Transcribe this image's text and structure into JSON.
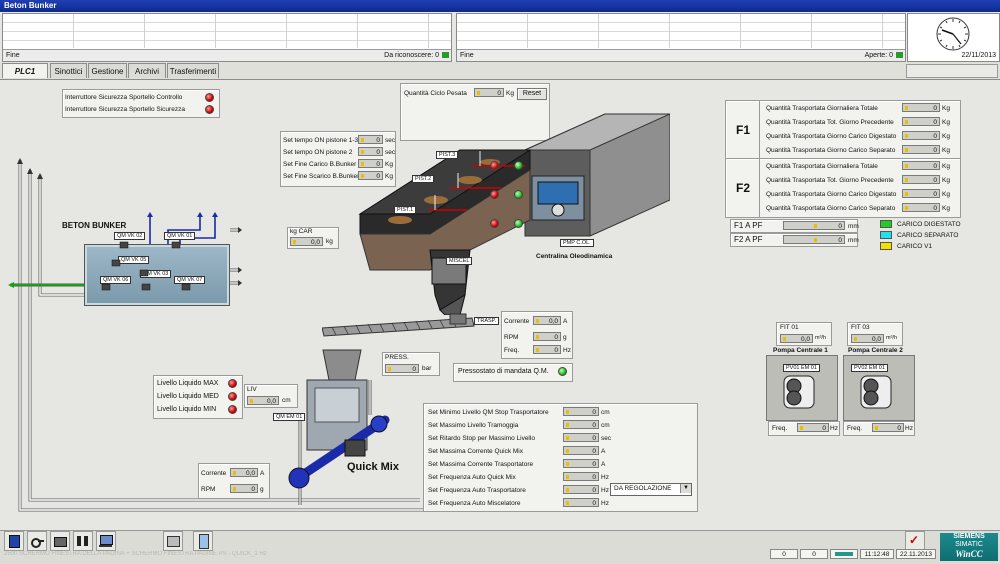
{
  "window": {
    "title": "Beton Bunker"
  },
  "alarms": {
    "left": {
      "footer_left": "Fine",
      "footer_right": "Da riconoscere: 0"
    },
    "right": {
      "footer_left": "Fine",
      "footer_right": "Aperte: 0"
    }
  },
  "clock": {
    "date": "22/11/2013"
  },
  "tabs": {
    "plc": "PLC1",
    "items": [
      "Sinottici",
      "Gestione",
      "Archivi",
      "Trasferimenti"
    ]
  },
  "safety": {
    "items": [
      "Interruttore Sicurezza Sportello Controllo",
      "Interruttore Sicurezza Sportello Sicurezza"
    ]
  },
  "ciclo": {
    "label": "Quantità Ciclo Pesata",
    "value": "0",
    "unit": "Kg",
    "reset": "Reset"
  },
  "setpoints": {
    "items": [
      {
        "label": "Set tempo ON pistone 1-3",
        "value": "0",
        "unit": "sec"
      },
      {
        "label": "Set tempo ON pistone 2",
        "value": "0",
        "unit": "sec"
      },
      {
        "label": "Set Fine Carico B.Bunker",
        "value": "0",
        "unit": "Kg"
      },
      {
        "label": "Set Fine Scarico B.Bunker",
        "value": "0",
        "unit": "Kg"
      }
    ]
  },
  "kgcar": {
    "label": "kg CAR",
    "value": "0,0",
    "unit": "kg"
  },
  "bunker": {
    "title": "BETON BUNKER",
    "valves": [
      "QM VK 02",
      "QM VK 01",
      "QM VK 05",
      "QM VK 03",
      "QM VK 06",
      "QM VK 07"
    ]
  },
  "machine": {
    "pistons": [
      "PIST.3",
      "PIST.2",
      "PIST.1"
    ],
    "miscel": "MISCEL",
    "pmp": "PMP C.OL.",
    "centralina": "Centralina Oleodinamica",
    "trasp": "TRASP."
  },
  "trasp_values": [
    {
      "label": "Corrente",
      "value": "0,0",
      "unit": "A"
    },
    {
      "label": "RPM",
      "value": "0",
      "unit": "g"
    },
    {
      "label": "Freq.",
      "value": "0",
      "unit": "Hz"
    }
  ],
  "pressostato": {
    "label": "Pressostato di mandata Q.M."
  },
  "press": {
    "label": "PRESS.",
    "value": "0",
    "unit": "bar"
  },
  "liv": {
    "label": "LIV",
    "value": "0,0",
    "unit": "cm"
  },
  "livelli": {
    "items": [
      "Livello Liquido MAX",
      "Livello Liquido MED",
      "Livello Liquido MIN"
    ]
  },
  "quickmix": {
    "title": "Quick Mix",
    "em": "QM EM 01",
    "values": [
      {
        "label": "Corrente",
        "value": "0,0",
        "unit": "A"
      },
      {
        "label": "RPM",
        "value": "0",
        "unit": "g"
      }
    ]
  },
  "f1": {
    "title": "F1",
    "rows": [
      {
        "label": "Quantità Trasportata Giornaliera Totale",
        "value": "0",
        "unit": "Kg"
      },
      {
        "label": "Quantità Trasportata Tot. Giorno Precedente",
        "value": "0",
        "unit": "Kg"
      },
      {
        "label": "Quantità Trasportata Giorno Carico Digestato",
        "value": "0",
        "unit": "Kg"
      },
      {
        "label": "Quantità Trasportata Giorno Carico Separato",
        "value": "0",
        "unit": "Kg"
      }
    ]
  },
  "f2": {
    "title": "F2",
    "rows": [
      {
        "label": "Quantità Trasportata Giornaliera Totale",
        "value": "0",
        "unit": "Kg"
      },
      {
        "label": "Quantità Trasportata Tot. Giorno Precedente",
        "value": "0",
        "unit": "Kg"
      },
      {
        "label": "Quantità Trasportata Giorno Carico Digestato",
        "value": "0",
        "unit": "Kg"
      },
      {
        "label": "Quantità Trasportata Giorno Carico Separato",
        "value": "0",
        "unit": "Kg"
      }
    ]
  },
  "pf": [
    {
      "label": "F1 A PF",
      "value": "0",
      "unit": "mm"
    },
    {
      "label": "F2 A PF",
      "value": "0",
      "unit": "mm"
    }
  ],
  "legend": [
    {
      "label": "CARICO DIGESTATO",
      "color": "#22cc22"
    },
    {
      "label": "CARICO SEPARATO",
      "color": "#22e0ee"
    },
    {
      "label": "CARICO V1",
      "color": "#f2e200"
    }
  ],
  "pumps": [
    {
      "fit": "FIT 01",
      "fit_value": "0,0",
      "fit_unit": "m³/h",
      "title": "Pompa Centrale 1",
      "em": "PV01 EM 01",
      "freq_label": "Freq.",
      "freq": "0",
      "freq_unit": "Hz"
    },
    {
      "fit": "FIT 03",
      "fit_value": "0,0",
      "fit_unit": "m³/h",
      "title": "Pompa Centrale 2",
      "em": "PV02 EM 01",
      "freq_label": "Freq.",
      "freq": "0",
      "freq_unit": "Hz"
    }
  ],
  "settings": {
    "rows": [
      {
        "label": "Set Minimo Livello QM Stop Trasportatore",
        "value": "0",
        "unit": "cm"
      },
      {
        "label": "Set Massimo Livello Tramoggia",
        "value": "0",
        "unit": "cm"
      },
      {
        "label": "Set Ritardo Stop per Massimo Livello",
        "value": "0",
        "unit": "sec"
      },
      {
        "label": "Set Massima Corrente Quick Mix",
        "value": "0",
        "unit": "A"
      },
      {
        "label": "Set Massima Corrente Trasportatore",
        "value": "0",
        "unit": "A"
      },
      {
        "label": "Set Frequenza Auto Quick Mix",
        "value": "0",
        "unit": "Hz"
      },
      {
        "label": "Set Frequenza Auto Trasportatore",
        "value": "0",
        "unit": "Hz"
      },
      {
        "label": "Set Frequenza Auto Miscelatore",
        "value": "0",
        "unit": "Hz"
      }
    ],
    "mode_select": "DA REGOLAZIONE"
  },
  "status": {
    "message": "2500 SCHERMO FINESTRA DELLA PAGINA + SCHERMO FINESTRA PAGINE PS - QUICK_1 Hz",
    "count1": "0",
    "count2": "0",
    "time": "11:12:48",
    "date": "22.11.2013",
    "brand1": "SIEMENS",
    "brand2": "SIMATIC",
    "brand3": "WinCC"
  }
}
